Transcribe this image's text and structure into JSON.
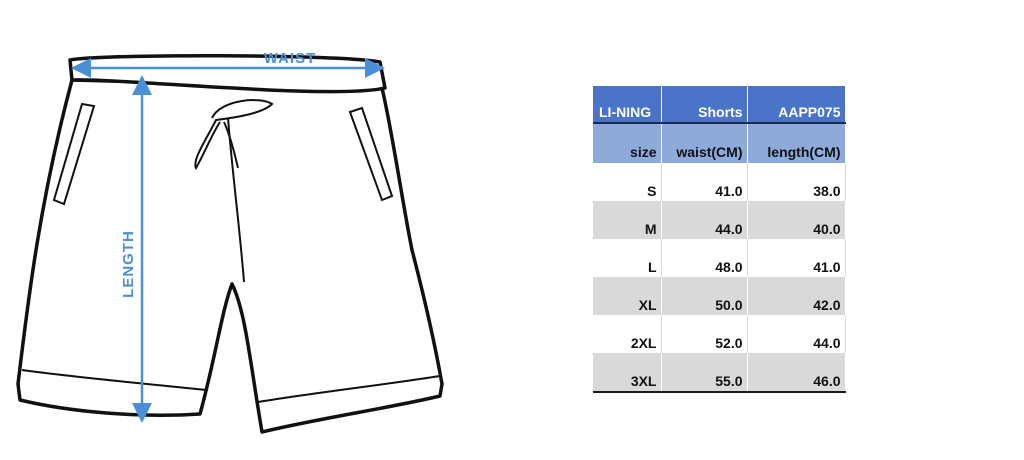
{
  "illustration": {
    "waist_label": "WAIST",
    "length_label": "LENGTH",
    "accent_color": "#4a90d9"
  },
  "size_table": {
    "brand_row": [
      "LI-NING",
      "Shorts",
      "AAPP075"
    ],
    "headers": [
      "size",
      "waist(CM)",
      "length(CM)"
    ],
    "rows": [
      [
        "S",
        "41.0",
        "38.0"
      ],
      [
        "M",
        "44.0",
        "40.0"
      ],
      [
        "L",
        "48.0",
        "41.0"
      ],
      [
        "XL",
        "50.0",
        "42.0"
      ],
      [
        "2XL",
        "52.0",
        "44.0"
      ],
      [
        "3XL",
        "55.0",
        "46.0"
      ]
    ],
    "colors": {
      "brand_bg": "#4a74c8",
      "header_bg": "#8eaadb",
      "band_grey": "#d9d9d9"
    }
  }
}
